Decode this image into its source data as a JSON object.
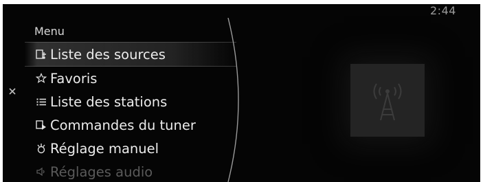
{
  "status_bar": {
    "clock": "2:44"
  },
  "menu": {
    "title": "Menu",
    "items": [
      {
        "label": "Liste des sources",
        "icon": "source-list-icon",
        "selected": true
      },
      {
        "label": "Favoris",
        "icon": "star-icon",
        "selected": false
      },
      {
        "label": "Liste des stations",
        "icon": "list-icon",
        "selected": false
      },
      {
        "label": "Commandes du tuner",
        "icon": "tuner-controls-icon",
        "selected": false
      },
      {
        "label": "Réglage manuel",
        "icon": "manual-tune-icon",
        "selected": false
      },
      {
        "label": "Réglages audio",
        "icon": "audio-settings-icon",
        "selected": false
      }
    ]
  },
  "artwork": {
    "icon": "radio-antenna-icon"
  },
  "colors": {
    "background": "#050505",
    "text": "#ececec",
    "selection": "#555555",
    "artwork_bg": "#242424"
  }
}
